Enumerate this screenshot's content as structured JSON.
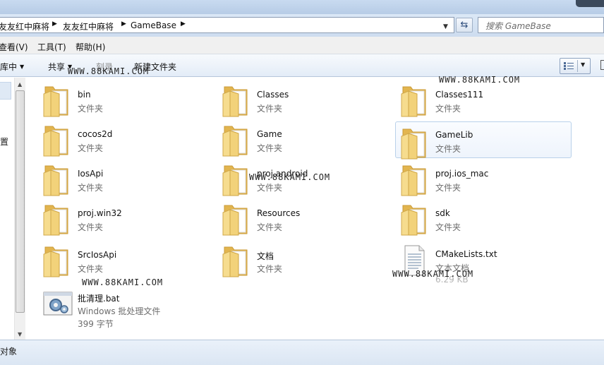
{
  "address_bar": {
    "breadcrumbs": [
      "友友红中麻将",
      "友友红中麻将",
      "GameBase"
    ],
    "search_placeholder": "搜索 GameBase"
  },
  "menu": {
    "items": [
      "查看(V)",
      "工具(T)",
      "帮助(H)"
    ]
  },
  "command_bar": {
    "include_in_library": "库中",
    "share": "共享",
    "burn": "刻录",
    "new_folder": "新建文件夹"
  },
  "nav_pane": {
    "partial_text": "置"
  },
  "files": [
    {
      "name": "bin",
      "type": "文件夹",
      "icon": "folder-icon"
    },
    {
      "name": "Classes",
      "type": "文件夹",
      "icon": "folder-icon"
    },
    {
      "name": "Classes111",
      "type": "文件夹",
      "icon": "folder-icon"
    },
    {
      "name": "cocos2d",
      "type": "文件夹",
      "icon": "folder-icon"
    },
    {
      "name": "Game",
      "type": "文件夹",
      "icon": "folder-icon"
    },
    {
      "name": "GameLib",
      "type": "文件夹",
      "icon": "folder-icon",
      "selected": true
    },
    {
      "name": "IosApi",
      "type": "文件夹",
      "icon": "folder-icon"
    },
    {
      "name": "proj.android",
      "type": "文件夹",
      "icon": "folder-icon"
    },
    {
      "name": "proj.ios_mac",
      "type": "文件夹",
      "icon": "folder-icon"
    },
    {
      "name": "proj.win32",
      "type": "文件夹",
      "icon": "folder-icon"
    },
    {
      "name": "Resources",
      "type": "文件夹",
      "icon": "folder-icon"
    },
    {
      "name": "sdk",
      "type": "文件夹",
      "icon": "folder-icon"
    },
    {
      "name": "SrcIosApi",
      "type": "文件夹",
      "icon": "folder-icon"
    },
    {
      "name": "文档",
      "type": "文件夹",
      "icon": "folder-icon"
    },
    {
      "name": "CMakeLists.txt",
      "type": "文本文档",
      "size": "6.29 KB",
      "icon": "text-file-icon"
    },
    {
      "name": "批清理.bat",
      "type": "Windows 批处理文件",
      "size": "399 字节",
      "icon": "batch-file-icon"
    }
  ],
  "watermark": "WWW.88KAMI.COM",
  "status_bar": {
    "text": "对象"
  },
  "colors": {
    "folder": "#f2d27a",
    "selection_border": "#b9d1ea",
    "chrome_blue": "#cddcef"
  }
}
